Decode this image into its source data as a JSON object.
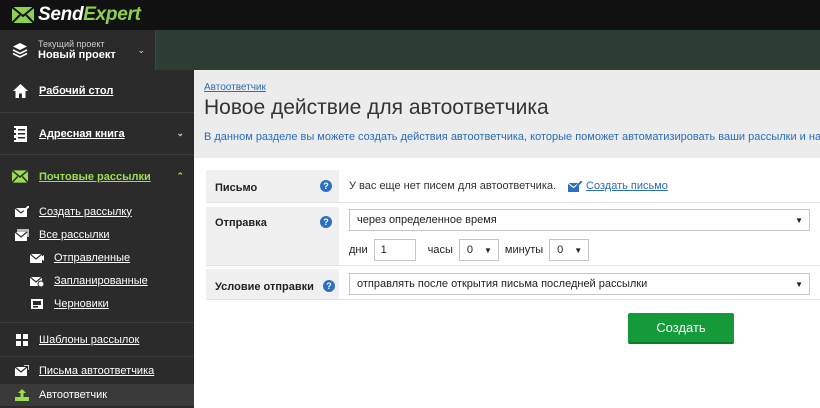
{
  "app": {
    "logo_prefix": "Send",
    "logo_suffix": "Expert",
    "colors": {
      "accent": "#9bde4d",
      "link": "#2a6ebb",
      "primary_button": "#159a3a",
      "help_icon": "#2d6fc3"
    }
  },
  "project": {
    "caption": "Текущий проект",
    "name": "Новый проект",
    "icon": "stack-icon"
  },
  "sidebar": {
    "items": [
      {
        "label": "Рабочий стол",
        "icon": "home-icon"
      },
      {
        "label": "Адресная книга",
        "icon": "address-book-icon"
      },
      {
        "label": "Почтовые рассылки",
        "icon": "envelope-icon"
      }
    ],
    "mailing_sub": [
      {
        "label": "Создать рассылку",
        "icon": "envelope-edit-icon"
      },
      {
        "label": "Все рассылки",
        "icon": "envelopes-icon"
      },
      {
        "label": "Отправленные",
        "icon": "envelope-sent-icon"
      },
      {
        "label": "Запланированные",
        "icon": "envelope-clock-icon"
      },
      {
        "label": "Черновики",
        "icon": "envelope-draft-icon"
      }
    ],
    "other": [
      {
        "label": "Шаблоны рассылок",
        "icon": "template-icon"
      },
      {
        "label": "Письма автоответчика",
        "icon": "autoresponder-letters-icon"
      },
      {
        "label": "Автоответчик",
        "icon": "autoresponder-icon"
      }
    ]
  },
  "content": {
    "breadcrumb": "Автоответчик",
    "title": "Новое действие для автоответчика",
    "description": "В данном разделе вы можете создать действия автоответчика, которые поможет автоматизировать ваши рассылки и нал"
  },
  "form": {
    "letter": {
      "label": "Письмо",
      "help": "?",
      "no_letters_text": "У вас еще нет писем для автоответчика.",
      "create_letter_link": "Создать письмо"
    },
    "send": {
      "label": "Отправка",
      "help": "?",
      "mode_value": "через определенное время",
      "days_label": "дни",
      "days_value": "1",
      "hours_label": "часы",
      "hours_value": "0",
      "minutes_label": "минуты",
      "minutes_value": "0"
    },
    "condition": {
      "label": "Условие отправки",
      "help": "?",
      "value": "отправлять после открытия письма последней рассылки"
    },
    "submit_label": "Создать"
  }
}
